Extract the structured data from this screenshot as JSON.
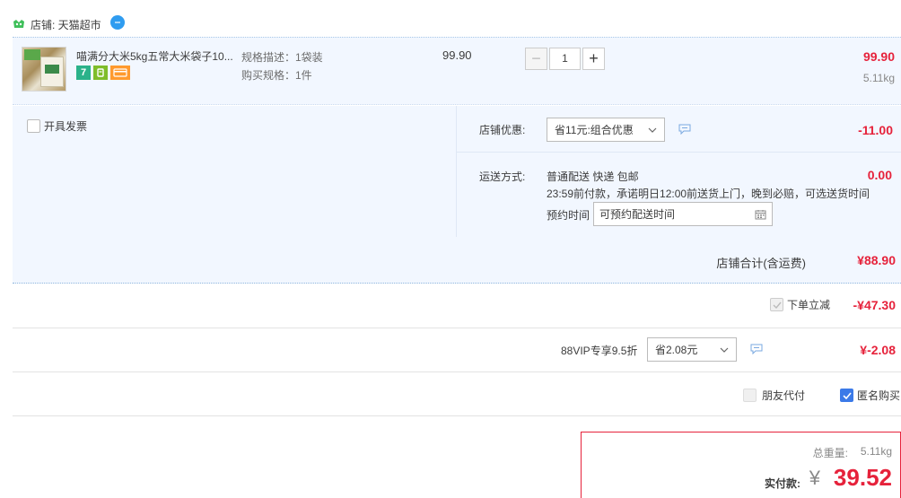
{
  "shop": {
    "label": "店铺: 天猫超市"
  },
  "item": {
    "title": "喵满分大米5kg五常大米袋子10...",
    "spec_desc": "规格描述：1袋装",
    "spec_buy": "购买规格：1件",
    "unit_price": "99.90",
    "quantity": "1",
    "minus": "−",
    "plus": "+",
    "subtotal": "99.90",
    "weight": "5.11kg"
  },
  "invoice": {
    "label": "开具发票"
  },
  "shop_discount": {
    "label": "店铺优惠:",
    "selected": "省11元:组合优惠",
    "amount": "-11.00"
  },
  "shipping": {
    "label": "运送方式:",
    "method": "普通配送 快递 包邮",
    "note": "23:59前付款，承诺明日12:00前送货上门，晚到必赔，可选送货时间",
    "appointment_label": "预约时间",
    "appointment_placeholder": "可预约配送时间",
    "amount": "0.00"
  },
  "store_total": {
    "label": "店铺合计(含运费)",
    "amount": "¥88.90"
  },
  "instant_discount": {
    "label": "下单立减",
    "amount": "-¥47.30"
  },
  "vip": {
    "label": "88VIP专享9.5折",
    "selected": "省2.08元",
    "amount": "¥-2.08"
  },
  "extras": {
    "friend_pay": "朋友代付",
    "anonymous": "匿名购买"
  },
  "summary": {
    "weight_label": "总重量:",
    "weight": "5.11kg",
    "pay_label": "实付款:",
    "currency": "¥",
    "amount": "39.52"
  },
  "colors": {
    "accent_red": "#e6223b",
    "panel_bg": "#f2f7ff",
    "checkbox_blue": "#3b7ae8"
  }
}
